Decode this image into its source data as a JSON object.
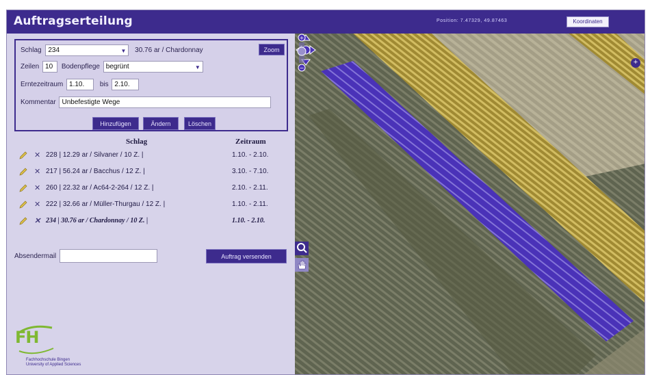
{
  "header": {
    "title": "Auftragserteilung",
    "position_text": "Position: 7.47329, 49.87463",
    "koord_button": "Koordinaten"
  },
  "form": {
    "schlag_label": "Schlag",
    "schlag_value": "234",
    "schlag_info": "30.76  ar /  Chardonnay",
    "zoom_label": "Zoom",
    "zeilen_label": "Zeilen",
    "zeilen_value": "10",
    "bodenpflege_label": "Bodenpflege",
    "bodenpflege_value": "begrünt",
    "ernte_label": "Erntezeitraum",
    "ernte_from": "1.10.",
    "bis_label": "bis",
    "ernte_to": "2.10.",
    "kommentar_label": "Kommentar",
    "kommentar_value": "Unbefestigte Wege",
    "btn_add": "Hinzufügen",
    "btn_edit": "Ändern",
    "btn_delete": "Löschen"
  },
  "list": {
    "col_schlag": "Schlag",
    "col_zeitraum": "Zeitraum",
    "rows": [
      {
        "text": "228 | 12.29 ar / Silvaner / 10 Z. |",
        "zeitraum": "1.10. - 2.10."
      },
      {
        "text": "217 | 56.24 ar / Bacchus / 12 Z. |",
        "zeitraum": "3.10. - 7.10."
      },
      {
        "text": "260 | 22.32 ar / Ac64-2-264 / 12 Z. |",
        "zeitraum": "2.10. - 2.11."
      },
      {
        "text": "222 | 32.66 ar / Müller-Thurgau / 12 Z. |",
        "zeitraum": "1.10. - 2.11."
      },
      {
        "text": "234 | 30.76 ar / Chardonnay / 10 Z. |",
        "zeitraum": "1.10. - 2.10."
      }
    ]
  },
  "absender": {
    "label": "Absendermail",
    "value": "",
    "send_button": "Auftrag versenden"
  },
  "logo": {
    "text": "FH",
    "line1": "Fachhochschule Bingen",
    "line2": "University of Applied Sciences"
  },
  "colors": {
    "header": "#3d2b8d",
    "panel": "#d7d3ea",
    "selection": "#4a32b8",
    "vineyard_yellow": "#b59c3c"
  }
}
